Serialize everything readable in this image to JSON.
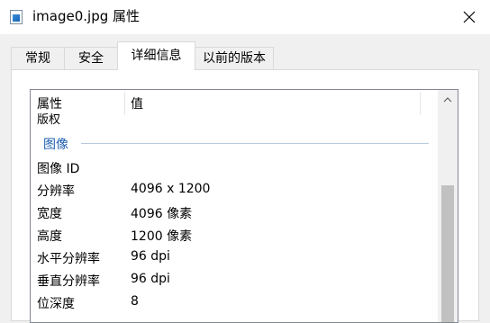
{
  "window": {
    "title": "image0.jpg 属性",
    "close_icon": "close-icon"
  },
  "tabs": [
    {
      "label": "常规"
    },
    {
      "label": "安全"
    },
    {
      "label": "详细信息",
      "active": true
    },
    {
      "label": "以前的版本"
    }
  ],
  "details": {
    "columns": {
      "property": "属性",
      "value": "值"
    },
    "cut_row": "版权",
    "group_label": "图像",
    "rows": [
      {
        "key": "图像 ID",
        "value": ""
      },
      {
        "key": "分辨率",
        "value": "4096 x 1200"
      },
      {
        "key": "宽度",
        "value": "4096 像素"
      },
      {
        "key": "高度",
        "value": "1200 像素"
      },
      {
        "key": "水平分辨率",
        "value": "96 dpi"
      },
      {
        "key": "垂直分辨率",
        "value": "96 dpi"
      },
      {
        "key": "位深度",
        "value": "8"
      }
    ]
  }
}
